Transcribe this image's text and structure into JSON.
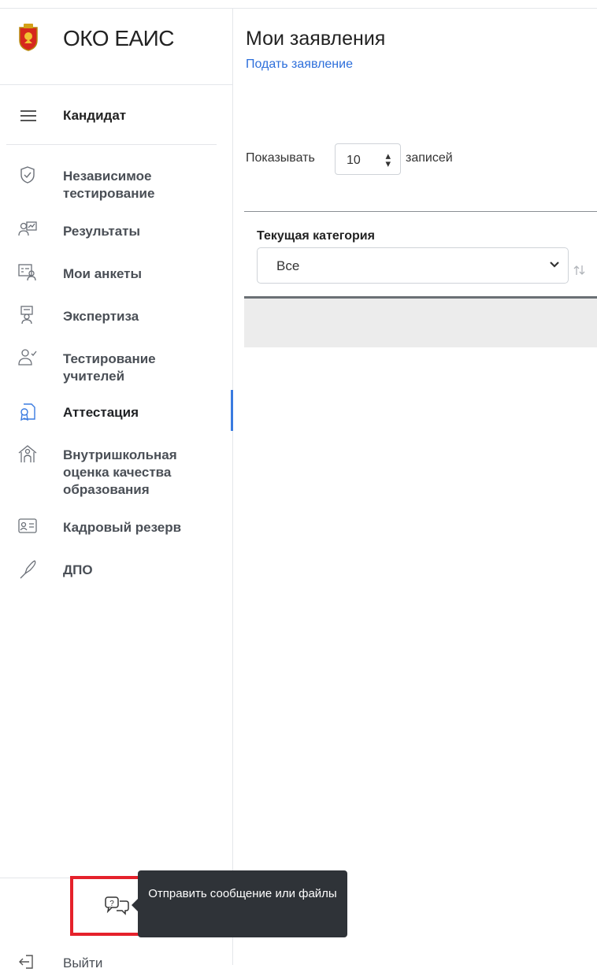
{
  "sidebar": {
    "brand": "ОКО ЕАИС",
    "role": "Кандидат",
    "items": [
      {
        "label": "Независимое тестирование",
        "icon": "shield-check-icon"
      },
      {
        "label": "Результаты",
        "icon": "results-icon"
      },
      {
        "label": "Мои анкеты",
        "icon": "questionnaire-icon"
      },
      {
        "label": "Экспертиза",
        "icon": "expertise-icon"
      },
      {
        "label": "Тестирование учителей",
        "icon": "user-check-icon"
      },
      {
        "label": "Аттестация",
        "icon": "certification-icon",
        "active": true
      },
      {
        "label": "Внутришкольная оценка качества образования",
        "icon": "school-icon"
      },
      {
        "label": "Кадровый резерв",
        "icon": "id-card-icon"
      },
      {
        "label": "ДПО",
        "icon": "pen-icon"
      }
    ],
    "logout": "Выйти"
  },
  "tooltip": "Отправить сообщение или файлы",
  "main": {
    "title": "Мои заявления",
    "apply_link": "Подать заявление",
    "show_label": "Показывать",
    "page_length": "10",
    "records_label": "записей",
    "column_header": "Текущая категория",
    "filter_value": "Все"
  },
  "colors": {
    "accent": "#3a7be0",
    "link": "#2d6fdb",
    "tooltip_bg": "#2f3338",
    "highlight": "#e5212b"
  }
}
